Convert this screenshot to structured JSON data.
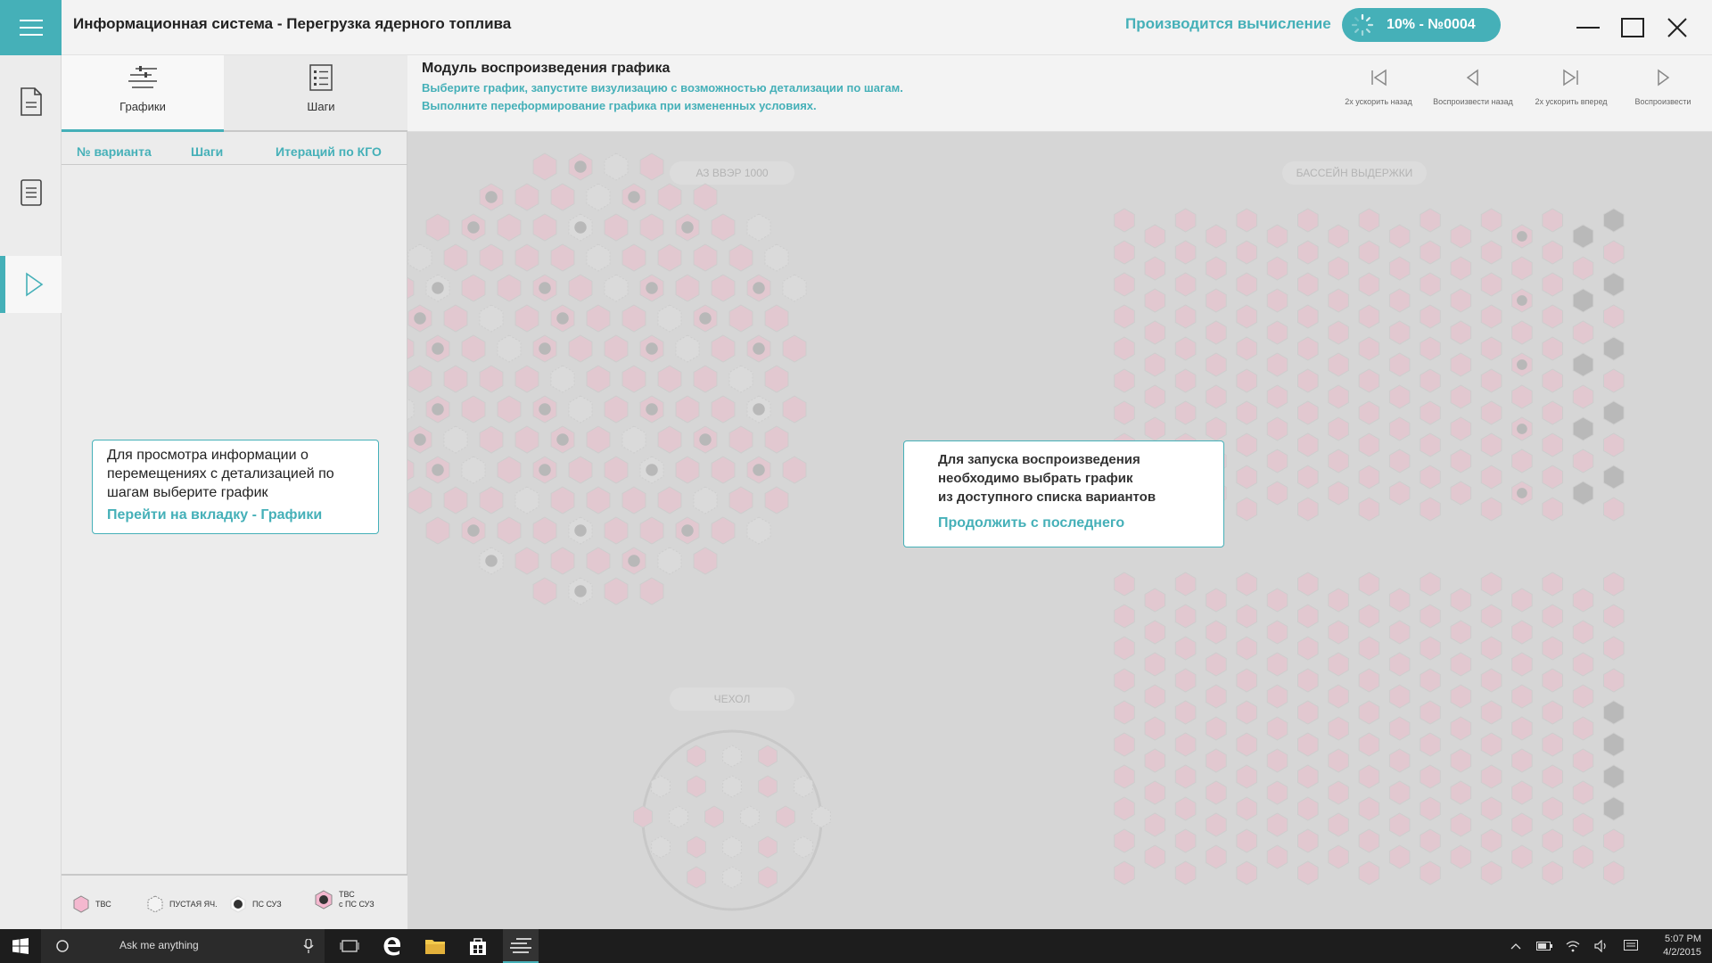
{
  "window": {
    "title": "Информационная система - Перегрузка ядерного топлива",
    "status_label": "Производится вычисление",
    "progress_text": "10% - №0004",
    "progress": 0.1
  },
  "tabs": [
    {
      "label": "Графики",
      "icon": "chart-icon"
    },
    {
      "label": "Шаги",
      "icon": "steps-list-icon"
    }
  ],
  "table": {
    "columns": [
      "№ варианта",
      "Шаги",
      "Итераций по КГО"
    ]
  },
  "left_hint": {
    "message": "Для просмотра информации о перемещениях с детализацией по шагам выберите график",
    "link": "Перейти на вкладку - Графики"
  },
  "legend": [
    {
      "label": "ТВС",
      "icon": "tvs-hex-icon"
    },
    {
      "label": "ПУСТАЯ ЯЧ.",
      "icon": "empty-cell-icon"
    },
    {
      "label": "ПС СУЗ",
      "icon": "ps-suz-icon"
    },
    {
      "label_1": "ТВС",
      "label_2": "с ПС СУЗ",
      "icon": "tvs-ps-suz-icon"
    }
  ],
  "module": {
    "title": "Модуль воспроизведения графика",
    "desc_1": "Выберите график, запустите визулизацию с возможностью детализации по шагам.",
    "desc_2": "Выполните переформирование графика при измененных условиях."
  },
  "controls": [
    {
      "label": "2x ускорить назад",
      "icon": "skip-back-icon"
    },
    {
      "label": "Воспроизвести назад",
      "icon": "play-back-icon"
    },
    {
      "label": "2x ускорить вперед",
      "icon": "skip-forward-icon"
    },
    {
      "label": "Воспроизвести",
      "icon": "play-icon"
    }
  ],
  "zones": {
    "core": "АЗ ВВЭР 1000",
    "pool": "БАССЕЙН ВЫДЕРЖКИ",
    "cover": "ЧЕХОЛ"
  },
  "center_dialog": {
    "message_1": "Для запуска воспроизведения",
    "message_2": "необходимо выбрать график",
    "message_3": "из доступного списка вариантов",
    "link": "Продолжить с последнего"
  },
  "taskbar": {
    "search_placeholder": "Ask me anything",
    "time": "5:07 PM",
    "date": "4/2/2015"
  },
  "colors": {
    "accent": "#45b0b8",
    "tvs_fill": "#e2c8d0",
    "empty_fill": "#dadada",
    "rod": "#b8b8b8"
  }
}
